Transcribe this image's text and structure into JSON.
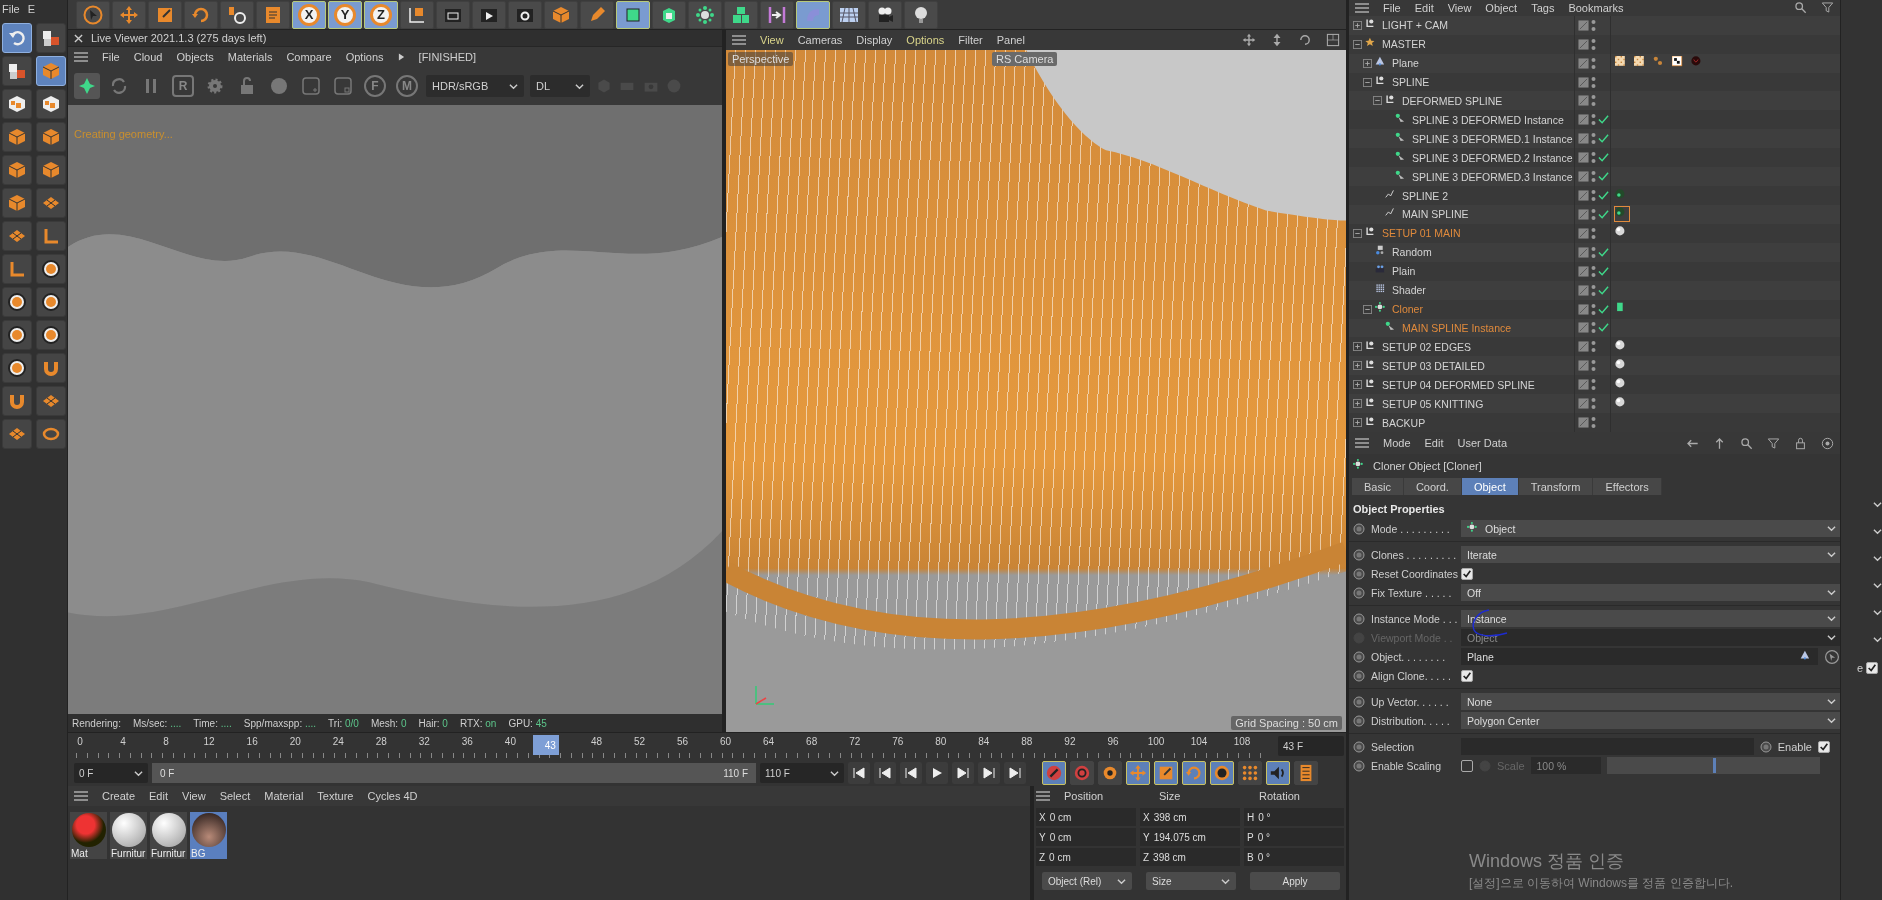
{
  "left_menu": [
    "File",
    "E"
  ],
  "left_tools": [
    {
      "kind": "undo",
      "selected": true
    },
    {
      "kind": "cubes",
      "selected": false
    },
    {
      "kind": "cubes",
      "selected": false
    },
    {
      "kind": "cube",
      "selected": true
    },
    {
      "kind": "checker",
      "selected": false
    },
    {
      "kind": "checker",
      "selected": false
    },
    {
      "kind": "cube",
      "selected": false
    },
    {
      "kind": "cube",
      "selected": false
    },
    {
      "kind": "cube",
      "selected": false
    },
    {
      "kind": "cube",
      "selected": false
    },
    {
      "kind": "cube",
      "selected": false
    },
    {
      "kind": "grid",
      "selected": false
    },
    {
      "kind": "grid",
      "selected": false
    },
    {
      "kind": "corner",
      "selected": false
    },
    {
      "kind": "corner",
      "selected": false
    },
    {
      "kind": "s-badge",
      "selected": false
    },
    {
      "kind": "s-badge",
      "selected": false
    },
    {
      "kind": "s-badge",
      "selected": false
    },
    {
      "kind": "s-badge",
      "selected": false
    },
    {
      "kind": "s-badge",
      "selected": false
    },
    {
      "kind": "s-badge",
      "selected": false
    },
    {
      "kind": "magnet",
      "selected": false
    },
    {
      "kind": "magnet",
      "selected": false
    },
    {
      "kind": "grid",
      "selected": false
    },
    {
      "kind": "grid",
      "selected": false
    },
    {
      "kind": "loop",
      "selected": false
    }
  ],
  "top_tools": [
    {
      "kind": "pointer",
      "selected": false
    },
    {
      "kind": "move",
      "selected": false
    },
    {
      "kind": "scale",
      "selected": false
    },
    {
      "kind": "rotate",
      "selected": false
    },
    {
      "kind": "psr",
      "selected": false
    },
    {
      "kind": "doc",
      "selected": false
    },
    {
      "kind": "axis",
      "glyph": "X",
      "selected": true
    },
    {
      "kind": "axis",
      "glyph": "Y",
      "selected": true
    },
    {
      "kind": "axis",
      "glyph": "Z",
      "selected": true
    },
    {
      "kind": "coord",
      "selected": false
    },
    {
      "kind": "render-region",
      "selected": false
    },
    {
      "kind": "render",
      "selected": false
    },
    {
      "kind": "render-settings",
      "selected": false
    },
    {
      "kind": "cube",
      "selected": false
    },
    {
      "kind": "pen",
      "selected": false
    },
    {
      "kind": "subdiv",
      "selected": true
    },
    {
      "kind": "extrude",
      "selected": false
    },
    {
      "kind": "cloner",
      "selected": false
    },
    {
      "kind": "cubes-green",
      "selected": false
    },
    {
      "kind": "deformer",
      "selected": false
    },
    {
      "kind": "bend",
      "selected": true
    },
    {
      "kind": "floor",
      "selected": false
    },
    {
      "kind": "camera",
      "selected": false
    },
    {
      "kind": "light",
      "selected": false
    }
  ],
  "live_viewer": {
    "title": "Live Viewer 2021.1.3 (275 days left)",
    "menu": [
      "File",
      "Cloud",
      "Objects",
      "Materials",
      "Compare",
      "Options"
    ],
    "status": "[FINISHED]",
    "tools": [
      {
        "kind": "aperture"
      },
      {
        "kind": "refresh"
      },
      {
        "kind": "pause"
      },
      {
        "kind": "letter",
        "glyph": "R"
      },
      {
        "kind": "gear"
      },
      {
        "kind": "lock"
      },
      {
        "kind": "ball"
      },
      {
        "kind": "plus-box"
      },
      {
        "kind": "small-box"
      },
      {
        "kind": "letter-round",
        "glyph": "F"
      },
      {
        "kind": "letter-round",
        "glyph": "M"
      }
    ],
    "dropdowns": [
      "HDR/sRGB",
      "DL"
    ],
    "message": "Creating geometry...",
    "stats": [
      {
        "label": "Rendering:"
      },
      {
        "label": "Ms/sec:",
        "value": "...."
      },
      {
        "label": "Time:",
        "value": "...."
      },
      {
        "label": "Spp/maxspp:",
        "value": "...."
      },
      {
        "label": "Tri:",
        "value": "0/0"
      },
      {
        "label": "Mesh:",
        "value": "0"
      },
      {
        "label": "Hair:",
        "value": "0"
      },
      {
        "label": "RTX:",
        "value": "on"
      },
      {
        "label": "GPU:",
        "value": "45"
      }
    ]
  },
  "viewport": {
    "menu": [
      {
        "label": "View",
        "accent": true
      },
      {
        "label": "Cameras",
        "accent": false
      },
      {
        "label": "Display",
        "accent": false
      },
      {
        "label": "Options",
        "accent": true
      },
      {
        "label": "Filter",
        "accent": false
      },
      {
        "label": "Panel",
        "accent": false
      }
    ],
    "view_name": "Perspective",
    "camera": "RS Camera",
    "grid_spacing": "Grid Spacing : 50 cm"
  },
  "timeline": {
    "ticks": [
      "0",
      "4",
      "8",
      "12",
      "16",
      "20",
      "24",
      "28",
      "32",
      "36",
      "40",
      "48",
      "52",
      "56",
      "60",
      "64",
      "68",
      "72",
      "76",
      "80",
      "84",
      "88",
      "92",
      "96",
      "100",
      "104",
      "108"
    ],
    "current": "43",
    "current_field": "43 F",
    "start_field": "0 F",
    "range": {
      "start": "0 F",
      "end": "110 F",
      "level": 1
    },
    "end_field": "110 F",
    "anim_tools": [
      {
        "kind": "record",
        "on": true
      },
      {
        "kind": "autokey",
        "on": false
      },
      {
        "kind": "keysel",
        "on": false
      },
      {
        "kind": "key-move",
        "on": true
      },
      {
        "kind": "key-scale",
        "on": true
      },
      {
        "kind": "key-rotate",
        "on": true
      },
      {
        "kind": "key-param",
        "on": true
      },
      {
        "kind": "key-pla",
        "on": false
      },
      {
        "kind": "sound",
        "on": true
      },
      {
        "kind": "film",
        "on": false
      }
    ]
  },
  "material_manager": {
    "menu": [
      "Create",
      "Edit",
      "View",
      "Select",
      "Material",
      "Texture",
      "Cycles 4D"
    ],
    "materials": [
      {
        "name": "Mat",
        "kind": "red",
        "selected": false
      },
      {
        "name": "Furnitur",
        "kind": "white",
        "selected": false
      },
      {
        "name": "Furnitur",
        "kind": "white",
        "selected": false
      },
      {
        "name": "BG",
        "kind": "skin",
        "selected": true
      }
    ]
  },
  "coordinates": {
    "headers": [
      "Position",
      "Size",
      "Rotation"
    ],
    "rows": [
      {
        "axis": "X",
        "position": "0 cm",
        "size_axis": "X",
        "size": "398 cm",
        "rot_axis": "H",
        "rotation": "0 °"
      },
      {
        "axis": "Y",
        "position": "0 cm",
        "size_axis": "Y",
        "size": "194.075 cm",
        "rot_axis": "P",
        "rotation": "0 °"
      },
      {
        "axis": "Z",
        "position": "0 cm",
        "size_axis": "Z",
        "size": "398 cm",
        "rot_axis": "B",
        "rotation": "0 °"
      }
    ],
    "mode": "Object (Rel)",
    "size_mode": "Size",
    "apply": "Apply"
  },
  "object_manager": {
    "menu": [
      "File",
      "Edit",
      "View",
      "Object",
      "Tags",
      "Bookmarks"
    ],
    "objects": [
      {
        "name": "LIGHT + CAM",
        "kind": "null",
        "expanded": false,
        "highlighted": false,
        "check": false
      },
      {
        "name": "MASTER",
        "kind": "star",
        "expanded": true,
        "highlighted": false,
        "check": false,
        "children": [
          {
            "name": "Plane",
            "kind": "plane",
            "expanded": false,
            "highlighted": false,
            "check": false,
            "tags": [
              {
                "kind": "checker-orange",
                "selected": false
              },
              {
                "kind": "checker-orange",
                "selected": false
              },
              {
                "kind": "dots",
                "selected": false
              },
              {
                "kind": "checker-bw",
                "selected": false
              },
              {
                "kind": "dark-material",
                "selected": false
              }
            ]
          },
          {
            "name": "SPLINE",
            "kind": "null",
            "expanded": true,
            "highlighted": false,
            "check": false,
            "children": [
              {
                "name": "DEFORMED SPLINE",
                "kind": "null",
                "expanded": true,
                "highlighted": false,
                "check": false,
                "children": [
                  {
                    "name": "SPLINE 3 DEFORMED Instance",
                    "kind": "instance",
                    "highlighted": false,
                    "check": true
                  },
                  {
                    "name": "SPLINE 3 DEFORMED.1 Instance",
                    "kind": "instance",
                    "highlighted": false,
                    "check": true
                  },
                  {
                    "name": "SPLINE 3 DEFORMED.2 Instance",
                    "kind": "instance",
                    "highlighted": false,
                    "check": true
                  },
                  {
                    "name": "SPLINE 3 DEFORMED.3 Instance",
                    "kind": "instance",
                    "highlighted": false,
                    "check": true
                  }
                ]
              },
              {
                "name": "SPLINE 2",
                "kind": "spline",
                "highlighted": false,
                "check": true,
                "tags": [
                  {
                    "kind": "green-dot",
                    "selected": false
                  }
                ]
              },
              {
                "name": "MAIN SPLINE",
                "kind": "spline",
                "highlighted": false,
                "check": true,
                "tags": [
                  {
                    "kind": "green-dot",
                    "selected": true
                  }
                ]
              }
            ]
          }
        ]
      },
      {
        "name": "SETUP 01 MAIN",
        "kind": "null",
        "expanded": true,
        "highlighted": true,
        "check": false,
        "tags": [
          {
            "kind": "sphere",
            "selected": false
          }
        ],
        "children": [
          {
            "name": "Random",
            "kind": "random",
            "highlighted": false,
            "check": true
          },
          {
            "name": "Plain",
            "kind": "plain",
            "highlighted": false,
            "check": true
          },
          {
            "name": "Shader",
            "kind": "shader",
            "highlighted": false,
            "check": true
          },
          {
            "name": "Cloner",
            "kind": "cloner",
            "expanded": true,
            "highlighted": true,
            "check": true,
            "tags": [
              {
                "kind": "green-bar",
                "selected": false
              }
            ],
            "children": [
              {
                "name": "MAIN SPLINE Instance",
                "kind": "instance",
                "highlighted": true,
                "check": true
              }
            ]
          }
        ]
      },
      {
        "name": "SETUP 02 EDGES",
        "kind": "null",
        "expanded": false,
        "highlighted": false,
        "check": false,
        "tags": [
          {
            "kind": "sphere",
            "selected": false
          }
        ]
      },
      {
        "name": "SETUP 03 DETAILED",
        "kind": "null",
        "expanded": false,
        "highlighted": false,
        "check": false,
        "tags": [
          {
            "kind": "sphere",
            "selected": false
          }
        ]
      },
      {
        "name": "SETUP 04 DEFORMED SPLINE",
        "kind": "null",
        "expanded": false,
        "highlighted": false,
        "check": false,
        "tags": [
          {
            "kind": "sphere",
            "selected": false
          }
        ]
      },
      {
        "name": "SETUP 05 KNITTING",
        "kind": "null",
        "expanded": false,
        "highlighted": false,
        "check": false,
        "tags": [
          {
            "kind": "sphere",
            "selected": false
          }
        ]
      },
      {
        "name": "BACKUP",
        "kind": "null",
        "expanded": false,
        "highlighted": false,
        "check": false
      }
    ]
  },
  "attributes": {
    "menu": [
      "Mode",
      "Edit",
      "User Data"
    ],
    "title": "Cloner Object [Cloner]",
    "tabs": [
      {
        "label": "Basic",
        "selected": false
      },
      {
        "label": "Coord.",
        "selected": false
      },
      {
        "label": "Object",
        "selected": true
      },
      {
        "label": "Transform",
        "selected": false
      },
      {
        "label": "Effectors",
        "selected": false
      }
    ],
    "section": "Object Properties",
    "params": [
      {
        "kind": "dropdown",
        "label": "Mode . . . . . . . . .",
        "value": "Object",
        "value_icon": true,
        "separator_after": true
      },
      {
        "kind": "dropdown",
        "label": "Clones . . . . . . . . .",
        "value": "Iterate"
      },
      {
        "kind": "checkbox",
        "label": "Reset Coordinates",
        "checked": true
      },
      {
        "kind": "dropdown",
        "label": "Fix Texture . . . . .",
        "value": "Off",
        "separator_after": true
      },
      {
        "kind": "dropdown",
        "label": "Instance Mode . . .",
        "value": "Instance"
      },
      {
        "kind": "dropdown",
        "label": "Viewport Mode . .",
        "value": "Object",
        "disabled": true
      },
      {
        "kind": "link",
        "label": "Object. . . . . . . .",
        "value": "Plane"
      },
      {
        "kind": "checkbox",
        "label": "Align Clone. . . . .",
        "checked": true,
        "separator_after": true
      },
      {
        "kind": "dropdown",
        "label": "Up Vector. . . . . .",
        "value": "None"
      },
      {
        "kind": "dropdown",
        "label": "Distribution. . . . .",
        "value": "Polygon Center",
        "separator_after": true
      },
      {
        "kind": "selection",
        "label": "Selection",
        "enable_label": "Enable",
        "checked": true
      },
      {
        "kind": "scaling",
        "label": "Enable Scaling",
        "checked": false,
        "scale_label": "Scale",
        "scale_value": "100 %",
        "level": 0.5
      }
    ]
  },
  "side_strip": {
    "label": "e",
    "checked": true
  },
  "os_notice": {
    "title": "Windows 정품 인증",
    "text": "[설정]으로 이동하여 Windows를 정품 인증합니다."
  }
}
